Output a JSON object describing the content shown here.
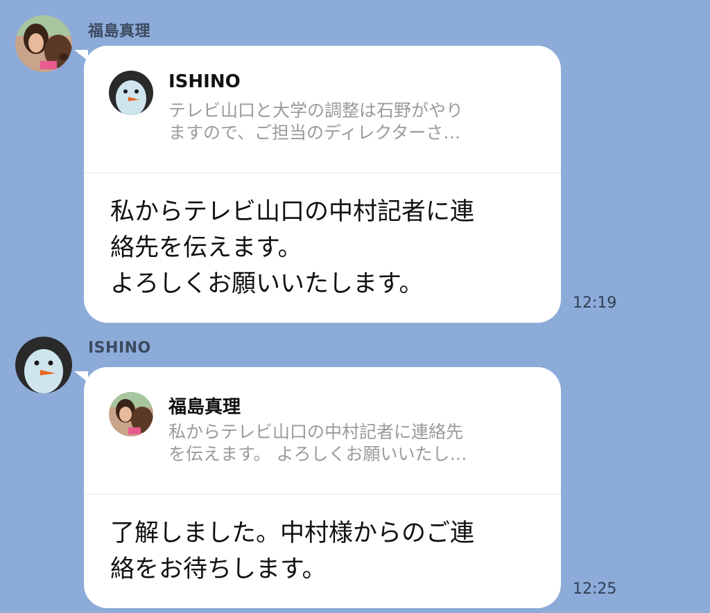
{
  "messages": [
    {
      "sender": "福島真理",
      "avatar_icon": "woman-with-capybara-avatar-icon",
      "quote": {
        "name": "ISHINO",
        "avatar_icon": "snow-bird-mask-avatar-icon",
        "text": "テレビ山口と大学の調整は石野がやり\nますので、ご担当のディレクターさ…"
      },
      "text": "私からテレビ山口の中村記者に連\n絡先を伝えます。\nよろしくお願いいたします。",
      "time": "12:19"
    },
    {
      "sender": "ISHINO",
      "avatar_icon": "snow-bird-mask-avatar-icon",
      "quote": {
        "name": "福島真理",
        "avatar_icon": "woman-with-capybara-avatar-icon",
        "text": "私からテレビ山口の中村記者に連絡先\nを伝えます。 よろしくお願いいたし…"
      },
      "text": "了解しました。中村様からのご連\n絡をお待ちします。",
      "time": "12:25"
    }
  ],
  "colors": {
    "background": "#8cabd9",
    "bubble": "#ffffff",
    "quote_text": "#9a9a9a",
    "sender_name": "#3b4a5e"
  }
}
